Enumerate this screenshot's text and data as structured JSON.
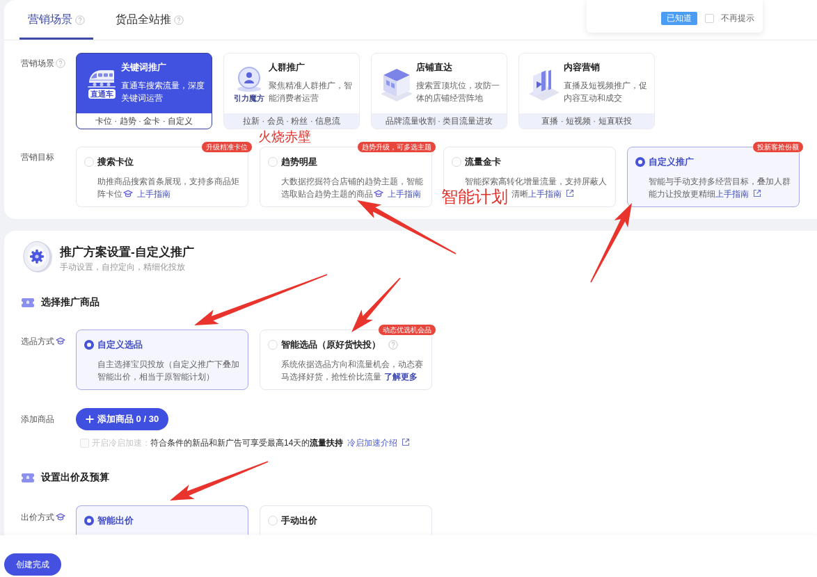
{
  "tabs": [
    {
      "label": "营销场景",
      "selected": true,
      "help": true
    },
    {
      "label": "货品全站推",
      "selected": false,
      "help": true
    }
  ],
  "tip_popup": {
    "button": "已知道",
    "checkbox": {
      "label": "不再提示",
      "checked": false
    }
  },
  "scenario": {
    "label": "营销场景",
    "help": true,
    "cards": [
      {
        "kind": "train",
        "title": "关键词推广",
        "icon_caption": "直通车",
        "description": "直通车搜索流量，深度关键词运营",
        "footer": "卡位 · 趋势 · 金卡 · 自定义",
        "selected": true
      },
      {
        "kind": "disc",
        "title": "人群推广",
        "icon_caption": "引力魔方",
        "description": "聚焦精准人群推广，智能消费者运营",
        "footer": "拉新 · 会员 · 粉丝 · 信息流",
        "selected": false,
        "annotation": "火烧赤壁"
      },
      {
        "kind": "building",
        "title": "店铺直达",
        "description": "搜索置顶坑位，攻防一体的店铺经营阵地",
        "footer": "品牌流量收割 · 类目流量进攻",
        "selected": false
      },
      {
        "kind": "video",
        "title": "内容营销",
        "description": "直播及短视频推广，促内容互动和成交",
        "footer": "直播 · 短视频 · 短直联投",
        "selected": false
      }
    ]
  },
  "goals": {
    "label": "营销目标",
    "cards": [
      {
        "kind": "tutorial",
        "title": "搜索卡位",
        "badge": "升级精准卡位",
        "description": "助推商品搜索首条展现，支持多商品矩阵卡位",
        "link": "上手指南",
        "selected": false
      },
      {
        "kind": "tutorial",
        "title": "趋势明星",
        "badge": "趋势升级，可多选主题",
        "description": "大数据挖掘符合店铺的趋势主题，智能选取贴合趋势主题的商品",
        "link": "上手指南",
        "selected": false
      },
      {
        "kind": "external",
        "title": "流量金卡",
        "description": "智能探索高转化增量流量，支持屏蔽人",
        "covered_tail": "清晰",
        "link": "上手指南",
        "selected": false,
        "annotation": "智能计划"
      },
      {
        "kind": "external",
        "title": "自定义推广",
        "badge": "投新客抢份额",
        "description": "智能与手动支持多经营目标，叠加人群能力让投放更精细",
        "link": "上手指南",
        "selected": true
      }
    ]
  },
  "plan": {
    "title": "推广方案设置-自定义推广",
    "subtitle": "手动设置，自控定向，精细化投放"
  },
  "product_section": {
    "title": "选择推广商品",
    "method": {
      "label": "选品方式",
      "guide_icon": true,
      "options": [
        {
          "title": "自定义选品",
          "description": "自主选择宝贝投放（自定义推广下叠加智能出价，相当于原智能计划）",
          "selected": true
        },
        {
          "title": "智能选品（原好货快投）",
          "help": true,
          "badge": "动态优选机会品",
          "description": "系统依据选品方向和流量机会，动态赛马选择好货，抢性价比流量",
          "link": "了解更多",
          "selected": false
        }
      ]
    },
    "add": {
      "label": "添加商品",
      "button": "添加商品 0 / 30"
    },
    "cold_start": {
      "label": "开启冷启加速：",
      "checked": false,
      "disabled": true,
      "text": "符合条件的新品和新广告可享受最高14天的**流量扶持**",
      "link": "冷启加速介绍"
    }
  },
  "bid_section": {
    "title": "设置出价及预算",
    "method": {
      "label": "出价方式",
      "guide_icon": true,
      "options": [
        {
          "title": "智能出价",
          "selected": true
        },
        {
          "title": "手动出价",
          "selected": false
        }
      ]
    }
  },
  "footer": {
    "button": "创建完成"
  }
}
